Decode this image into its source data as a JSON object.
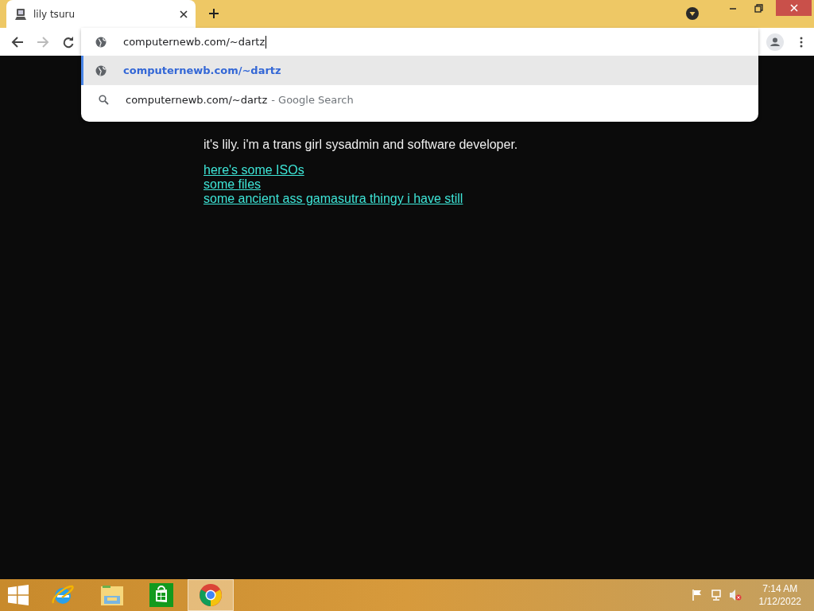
{
  "tabs": [
    {
      "title": "lily tsuru",
      "selected": true
    }
  ],
  "omnibox": {
    "value": "computernewb.com/~dartz"
  },
  "suggestions": [
    {
      "kind": "url",
      "text": "computernewb.com/~dartz",
      "selected": true
    },
    {
      "kind": "search",
      "text": "computernewb.com/~dartz",
      "suffix": "- Google Search",
      "selected": false
    }
  ],
  "page": {
    "intro": "it's lily. i'm a trans girl sysadmin and software developer.",
    "links": [
      "here's some ISOs",
      "some files",
      "some ancient ass gamasutra thingy i have still"
    ]
  },
  "taskbar": {
    "apps": [
      {
        "kind": "ie",
        "selected": false
      },
      {
        "kind": "explorer",
        "selected": false
      },
      {
        "kind": "store",
        "selected": false
      },
      {
        "kind": "chrome",
        "selected": true
      }
    ],
    "time": "7:14 AM",
    "date": "1/12/2022"
  }
}
